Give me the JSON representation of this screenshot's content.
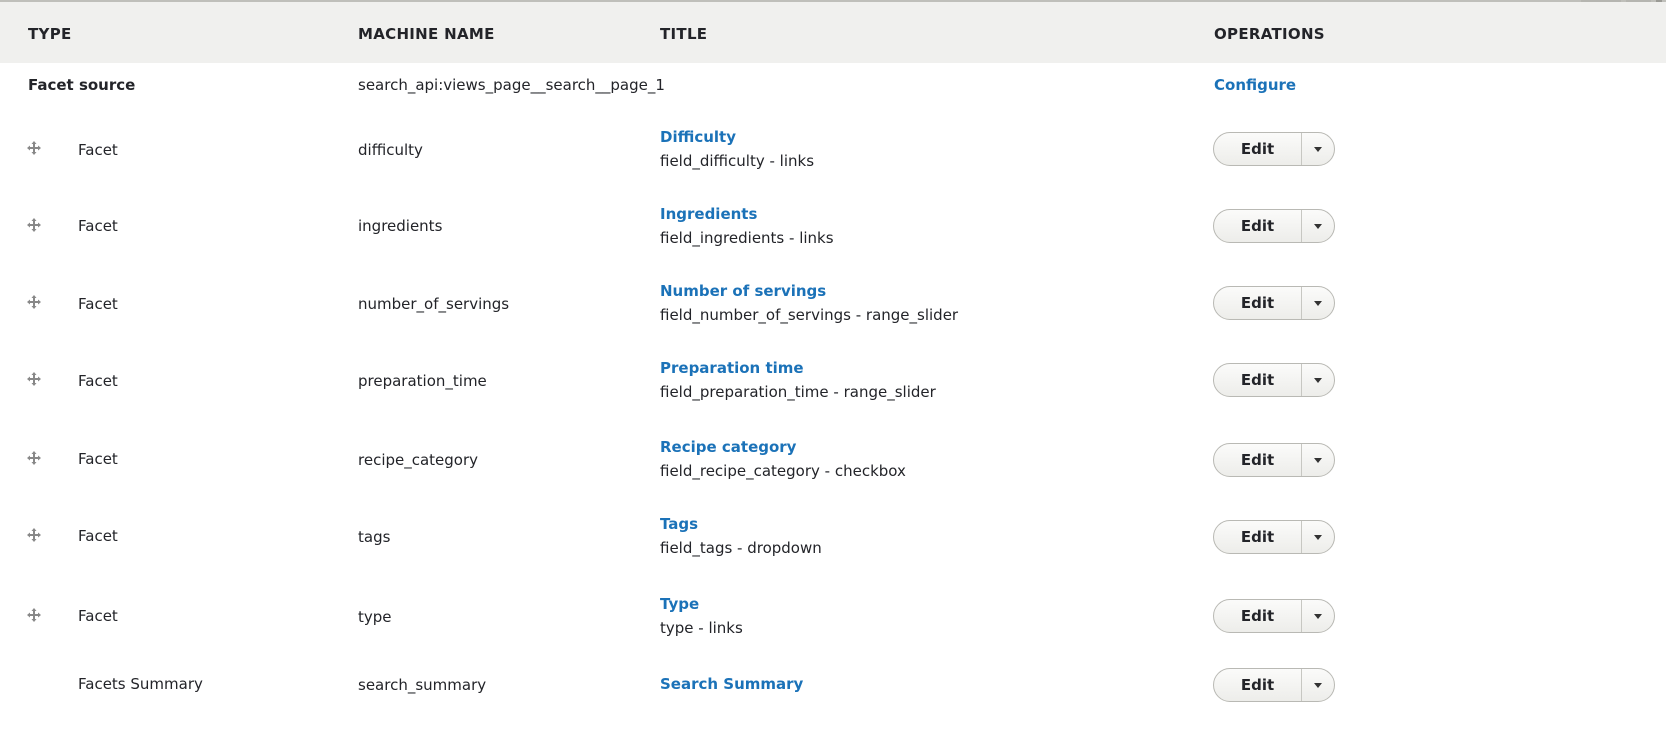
{
  "header": {
    "type": "TYPE",
    "machine_name": "MACHINE NAME",
    "title": "TITLE",
    "operations": "OPERATIONS"
  },
  "facet_source": {
    "type": "Facet source",
    "machine_name": "search_api:views_page__search__page_1",
    "operation": "Configure"
  },
  "rows": [
    {
      "type": "Facet",
      "machine_name": "difficulty",
      "title": "Difficulty",
      "desc": "field_difficulty - links",
      "edit": "Edit"
    },
    {
      "type": "Facet",
      "machine_name": "ingredients",
      "title": "Ingredients",
      "desc": "field_ingredients - links",
      "edit": "Edit"
    },
    {
      "type": "Facet",
      "machine_name": "number_of_servings",
      "title": "Number of servings",
      "desc": "field_number_of_servings - range_slider",
      "edit": "Edit"
    },
    {
      "type": "Facet",
      "machine_name": "preparation_time",
      "title": "Preparation time",
      "desc": "field_preparation_time - range_slider",
      "edit": "Edit"
    },
    {
      "type": "Facet",
      "machine_name": "recipe_category",
      "title": "Recipe category",
      "desc": "field_recipe_category - checkbox",
      "edit": "Edit"
    },
    {
      "type": "Facet",
      "machine_name": "tags",
      "title": "Tags",
      "desc": "field_tags - dropdown",
      "edit": "Edit"
    },
    {
      "type": "Facet",
      "machine_name": "type",
      "title": "Type",
      "desc": "type - links",
      "edit": "Edit"
    }
  ],
  "summary_row": {
    "type": "Facets Summary",
    "machine_name": "search_summary",
    "title": "Search Summary",
    "edit": "Edit"
  },
  "icons": {
    "drag": "drag-handle-icon",
    "toggle": "chevron-down-icon"
  },
  "colors": {
    "link": "#1b72b8",
    "header_bg": "#f0f0ee",
    "text": "#232429"
  }
}
